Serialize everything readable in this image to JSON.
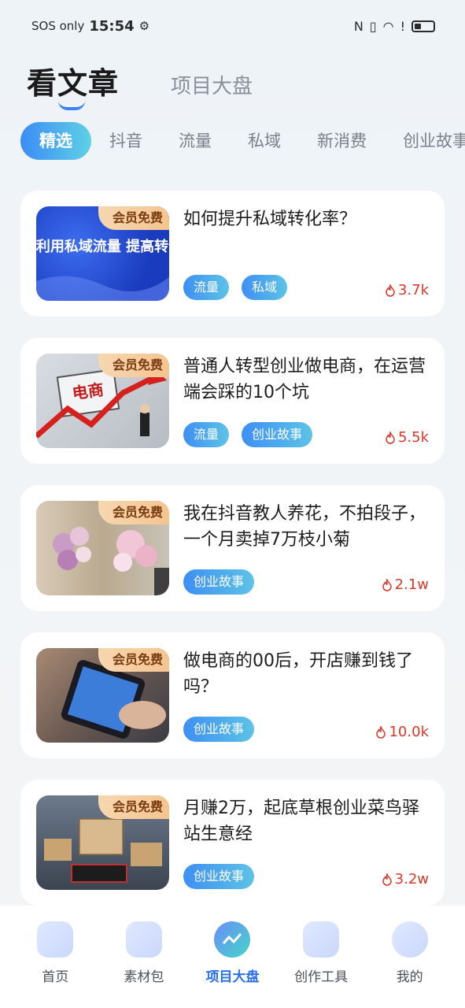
{
  "status_bar": {
    "carrier": "SOS only",
    "time": "15:54"
  },
  "header": {
    "title": "看文章",
    "secondary_tab": "项目大盘"
  },
  "tabs": [
    "精选",
    "抖音",
    "流量",
    "私域",
    "新消费",
    "创业故事"
  ],
  "active_tab": "精选",
  "articles": [
    {
      "badge": "会员免费",
      "title": "如何提升私域转化率？",
      "tags": [
        "流量",
        "私域"
      ],
      "views": "3.7k",
      "thumb_caption": "如何利用私域流量 提高转化？"
    },
    {
      "badge": "会员免费",
      "title": "普通人转型创业做电商，在运营端会踩的10个坑",
      "tags": [
        "流量",
        "创业故事"
      ],
      "views": "5.5k",
      "thumb_caption": "电商"
    },
    {
      "badge": "会员免费",
      "title": "我在抖音教人养花，不拍段子，一个月卖掉7万枝小菊",
      "tags": [
        "创业故事"
      ],
      "views": "2.1w"
    },
    {
      "badge": "会员免费",
      "title": "做电商的00后，开店赚到钱了吗？",
      "tags": [
        "创业故事"
      ],
      "views": "10.0k"
    },
    {
      "badge": "会员免费",
      "title": "月赚2万，起底草根创业菜鸟驿站生意经",
      "tags": [
        "创业故事"
      ],
      "views": "3.2w"
    }
  ],
  "bottom_nav": [
    {
      "label": "首页",
      "icon": "home-icon"
    },
    {
      "label": "素材包",
      "icon": "folder-icon"
    },
    {
      "label": "项目大盘",
      "icon": "chart-icon"
    },
    {
      "label": "创作工具",
      "icon": "toolbox-icon"
    },
    {
      "label": "我的",
      "icon": "profile-icon"
    }
  ],
  "colors": {
    "accent": "#3b82f6",
    "views_red": "#d8382b",
    "badge_gold": "#f5c48f"
  }
}
